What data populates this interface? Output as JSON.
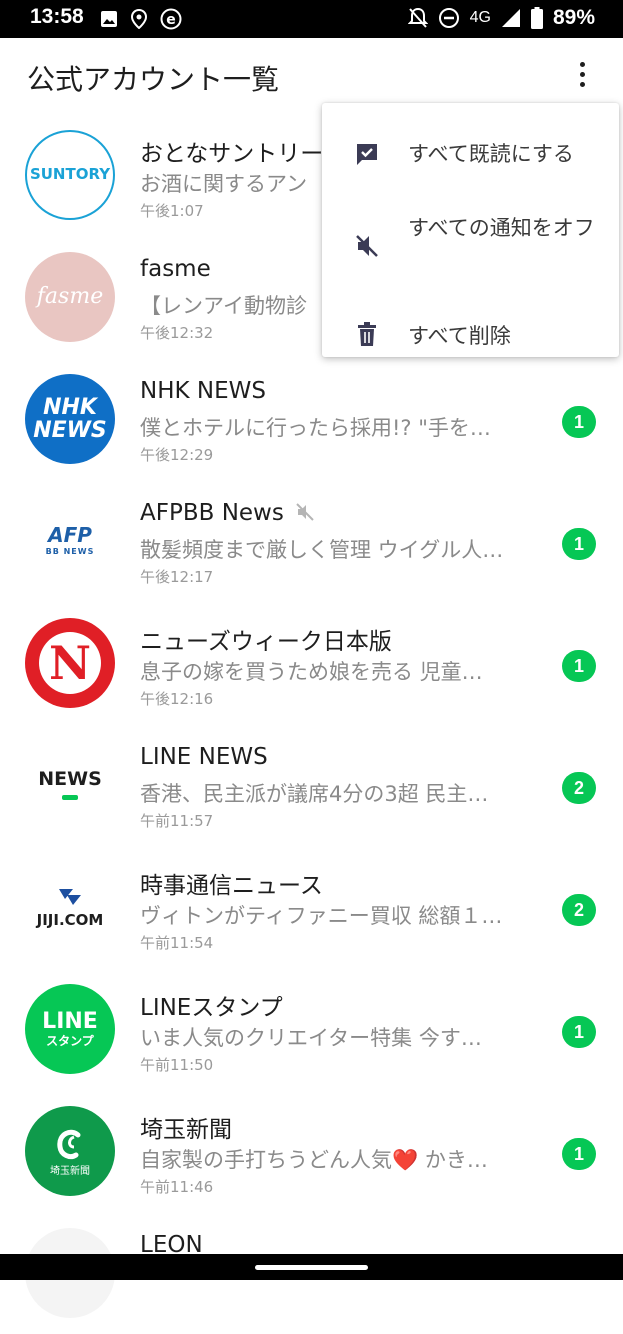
{
  "status_bar": {
    "time": "13:58",
    "network": "4G",
    "battery": "89%"
  },
  "header": {
    "title": "公式アカウント一覧"
  },
  "menu": {
    "items": [
      {
        "label": "すべて既読にする",
        "icon": "mark-read-icon"
      },
      {
        "label": "すべての通知をオフ",
        "icon": "mute-icon"
      },
      {
        "label": "すべて削除",
        "icon": "trash-icon"
      }
    ]
  },
  "accounts": [
    {
      "name": "おとなサントリー",
      "preview": "お酒に関するアン",
      "time": "午後1:07",
      "badge": "",
      "logo": "SUNTORY"
    },
    {
      "name": "fasme",
      "preview": "【レンアイ動物診",
      "time": "午後12:32",
      "badge": "",
      "logo": "fasme"
    },
    {
      "name": "NHK NEWS",
      "preview": "僕とホテルに行ったら採用!? \"手を…",
      "time": "午後12:29",
      "badge": "1",
      "logo_top": "NHK",
      "logo_bottom": "NEWS"
    },
    {
      "name": "AFPBB News",
      "preview": "散髪頻度まで厳しく管理 ウイグル人…",
      "time": "午後12:17",
      "badge": "1",
      "logo_top": "AFP",
      "logo_bottom": "BB NEWS",
      "muted": true
    },
    {
      "name": "ニューズウィーク日本版",
      "preview": "息子の嫁を買うため娘を売る 児童…",
      "time": "午後12:16",
      "badge": "1",
      "logo": "N"
    },
    {
      "name": "LINE NEWS",
      "preview": "香港、民主派が議席4分の3超 民主…",
      "time": "午前11:57",
      "badge": "2",
      "logo": "NEWS"
    },
    {
      "name": "時事通信ニュース",
      "preview": "ヴィトンがティファニー買収 総額１…",
      "time": "午前11:54",
      "badge": "2",
      "logo": "JIJI.COM"
    },
    {
      "name": "LINEスタンプ",
      "preview": "いま人気のクリエイター特集 今す…",
      "time": "午前11:50",
      "badge": "1",
      "logo_top": "LINE",
      "logo_bottom": "スタンプ"
    },
    {
      "name": "埼玉新聞",
      "preview": "自家製の手打ちうどん人気❤️ かき…",
      "time": "午前11:46",
      "badge": "1",
      "logo_bottom": "埼玉新聞"
    },
    {
      "name": "LEON",
      "preview": "",
      "time": "",
      "badge": ""
    }
  ],
  "colors": {
    "badge": "#06c755",
    "text_primary": "#1e1e1e",
    "text_secondary": "#8a8a8a"
  }
}
